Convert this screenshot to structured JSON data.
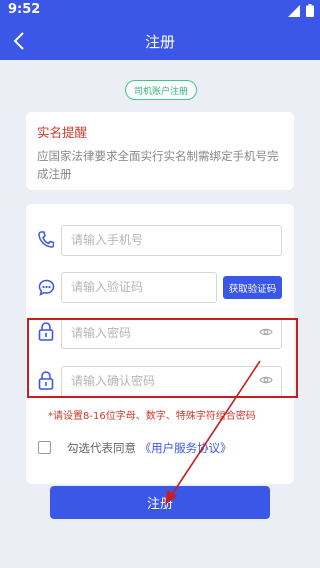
{
  "status_bar": {
    "time": "9:52"
  },
  "header": {
    "title": "注册"
  },
  "badge": "司机账户注册",
  "notice": {
    "title": "实名提醒",
    "text": "应国家法律要求全面实行实名制需绑定手机号完成注册"
  },
  "form": {
    "phone_placeholder": "请输入手机号",
    "code_placeholder": "请输入验证码",
    "get_code_label": "获取验证码",
    "password_placeholder": "请输入密码",
    "confirm_placeholder": "请输入确认密码",
    "password_hint": "*请设置8-16位字母、数字、特殊字符组合密码",
    "agree_prefix": "勾选代表同意",
    "agree_link": "《用户服务协议》",
    "submit_label": "注册"
  },
  "colors": {
    "primary": "#3a57e8",
    "alert": "#d0392c",
    "badge": "#2fb27a",
    "annotation": "#c81e1e"
  },
  "icons": [
    "signal-icon",
    "battery-icon",
    "back-arrow-icon",
    "phone-icon",
    "chat-icon",
    "lock-icon",
    "eye-icon"
  ]
}
